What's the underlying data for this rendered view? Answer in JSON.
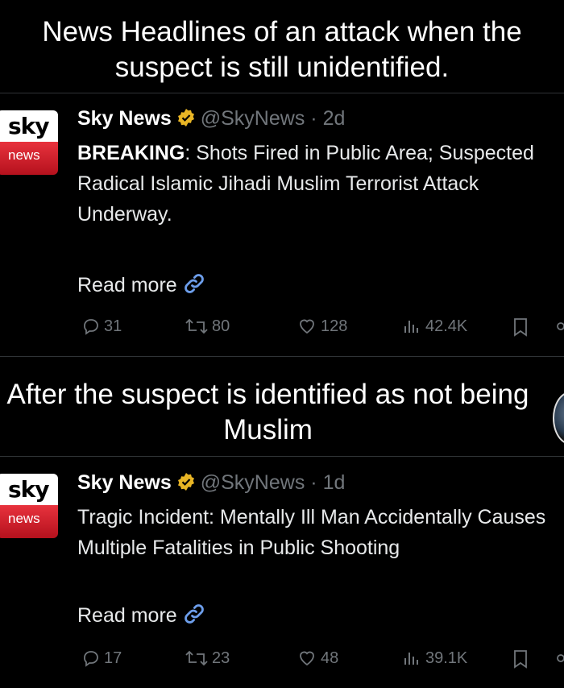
{
  "captions": {
    "top": "News Headlines of an attack when the suspect is still unidentified.",
    "middle": "After the suspect is identified as not being Muslim"
  },
  "colors": {
    "background": "#000000",
    "verified": "#e8b525",
    "logo_red": "#d91f2b",
    "muted": "#71767b"
  },
  "tweets": [
    {
      "logo_top": "sky",
      "logo_bottom": "news",
      "name": "Sky News",
      "handle": "@SkyNews",
      "separator": "·",
      "age": "2d",
      "lead": "BREAKING",
      "text": ": Shots Fired in Public Area; Suspected Radical Islamic Jihadi Muslim Terrorist Attack Underway.",
      "read_more": "Read more",
      "replies": "31",
      "reposts": "80",
      "likes": "128",
      "views": "42.4K"
    },
    {
      "logo_top": "sky",
      "logo_bottom": "news",
      "name": "Sky News",
      "handle": "@SkyNews",
      "separator": "·",
      "age": "1d",
      "lead": "",
      "text": "Tragic Incident: Mentally Ill Man Accidentally Causes Multiple Fatalities in Public Shooting",
      "read_more": "Read more",
      "replies": "17",
      "reposts": "23",
      "likes": "48",
      "views": "39.1K"
    }
  ],
  "icons": [
    "verified-badge-icon",
    "link-icon",
    "reply-icon",
    "repost-icon",
    "like-icon",
    "views-icon",
    "bookmark-icon",
    "share-icon"
  ]
}
